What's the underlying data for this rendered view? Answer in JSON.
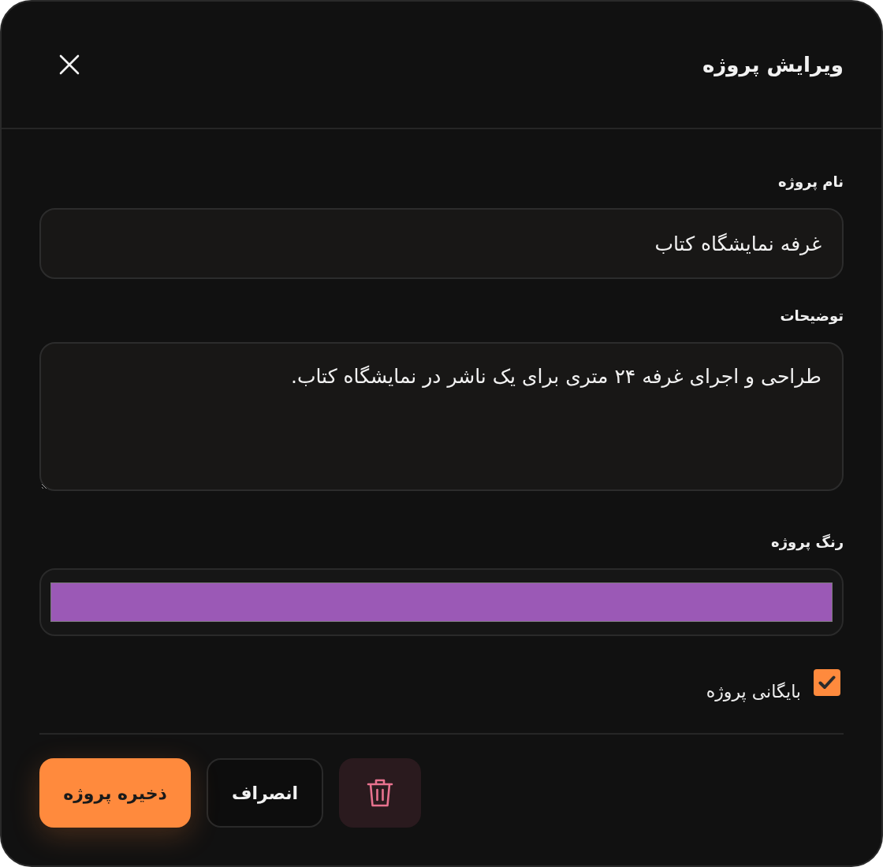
{
  "dialog": {
    "title": "ویرایش پروژه"
  },
  "name_field": {
    "label": "نام پروژه",
    "value": "غرفه نمایشگاه کتاب"
  },
  "description_field": {
    "label": "توضیحات",
    "value": "طراحی و اجرای غرفه ۲۴ متری برای یک ناشر در نمایشگاه کتاب."
  },
  "color_field": {
    "label": "رنگ پروژه",
    "color": "#9b59b6"
  },
  "archive_checkbox": {
    "label": "بایگانی پروژه",
    "checked": true
  },
  "buttons": [
    {
      "kind": "delete"
    },
    {
      "kind": "cancel",
      "label": "انصراف"
    },
    {
      "kind": "save",
      "label": "ذخیره پروژه"
    }
  ]
}
